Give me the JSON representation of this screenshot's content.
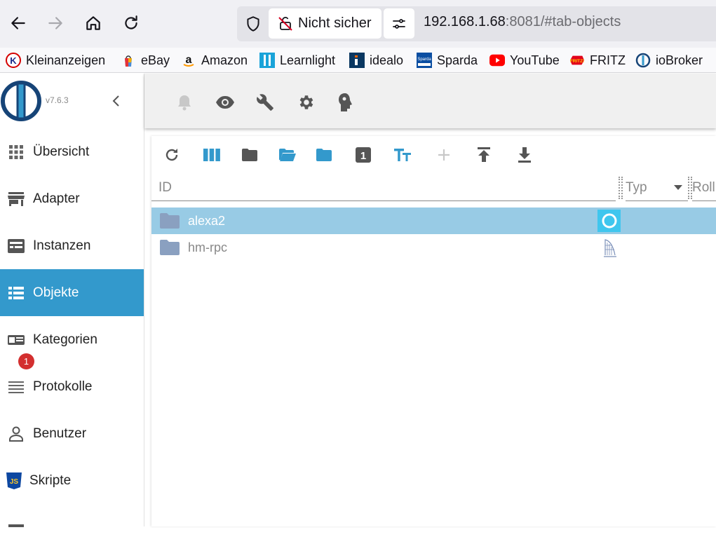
{
  "browser": {
    "security_label": "Nicht sicher",
    "url_host": "192.168.1.68",
    "url_rest": ":8081/#tab-objects"
  },
  "bookmarks": [
    {
      "label": "Kleinanzeigen",
      "icon": "kleinanzeigen-icon"
    },
    {
      "label": "eBay",
      "icon": "ebay-icon"
    },
    {
      "label": "Amazon",
      "icon": "amazon-icon"
    },
    {
      "label": "Learnlight",
      "icon": "learnlight-icon"
    },
    {
      "label": "idealo",
      "icon": "idealo-icon"
    },
    {
      "label": "Sparda",
      "icon": "sparda-icon"
    },
    {
      "label": "YouTube",
      "icon": "youtube-icon"
    },
    {
      "label": "FRITZ",
      "icon": "fritz-icon"
    },
    {
      "label": "ioBroker",
      "icon": "iobroker-icon"
    }
  ],
  "sidebar": {
    "version": "v7.6.3",
    "items": [
      {
        "label": "Übersicht",
        "icon": "grid-icon"
      },
      {
        "label": "Adapter",
        "icon": "store-icon"
      },
      {
        "label": "Instanzen",
        "icon": "instances-icon"
      },
      {
        "label": "Objekte",
        "icon": "list-icon",
        "active": true
      },
      {
        "label": "Kategorien",
        "icon": "categories-icon"
      },
      {
        "label": "Protokolle",
        "icon": "log-icon",
        "badge": "1"
      },
      {
        "label": "Benutzer",
        "icon": "user-icon"
      },
      {
        "label": "Skripte",
        "icon": "javascript-icon"
      }
    ]
  },
  "objects": {
    "columns": {
      "id": "ID",
      "type": "Typ",
      "role": "Roll"
    },
    "rows": [
      {
        "name": "alexa2",
        "selected": true,
        "icon": "alexa-icon"
      },
      {
        "name": "hm-rpc",
        "selected": false,
        "icon": "homematic-icon"
      }
    ]
  },
  "colors": {
    "accent": "#3399cc",
    "selected_row": "#98cbe5",
    "badge": "#d32f2f"
  }
}
